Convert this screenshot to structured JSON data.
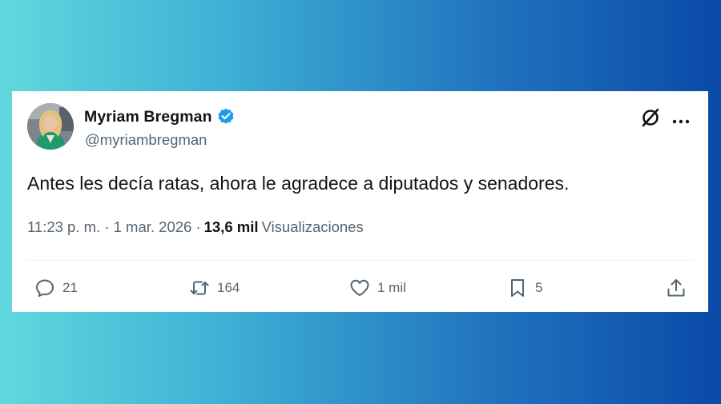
{
  "tweet": {
    "author_name": "Myriam Bregman",
    "handle": "@myriambregman",
    "text": "Antes les decía ratas, ahora le agradece a diputados y senadores.",
    "timestamp": "11:23 p. m. · 1 mar. 2026 ·",
    "views_count": "13,6 mil",
    "views_label": "Visualizaciones",
    "verified": true
  },
  "actions": {
    "replies": "21",
    "reposts": "164",
    "likes": "1 mil",
    "bookmarks": "5"
  },
  "icons": {
    "verified": "verified-badge-icon",
    "grok": "grok-icon",
    "more": "more-icon",
    "reply": "reply-icon",
    "retweet": "retweet-icon",
    "like": "heart-icon",
    "bookmark": "bookmark-icon",
    "share": "share-icon"
  },
  "colors": {
    "verified_blue": "#1d9bf0",
    "text_primary": "#0f1419",
    "text_secondary": "#536471"
  }
}
